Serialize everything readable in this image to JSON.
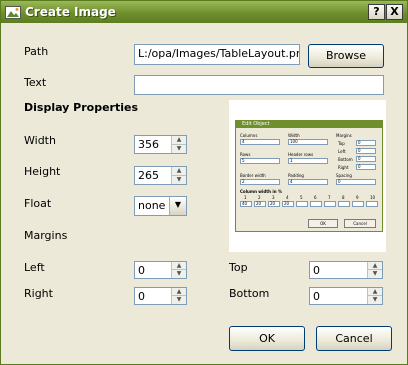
{
  "window": {
    "title": "Create Image",
    "help_btn": "?",
    "close_btn": "X"
  },
  "form": {
    "path_label": "Path",
    "path_value": "L:/opa/Images/TableLayout.png",
    "browse": "Browse",
    "text_label": "Text",
    "text_value": "",
    "display_heading": "Display Properties",
    "width_label": "Width",
    "width_value": "356",
    "height_label": "Height",
    "height_value": "265",
    "float_label": "Float",
    "float_value": "none",
    "margins_label": "Margins",
    "left_label": "Left",
    "left_value": "0",
    "top_label": "Top",
    "top_value": "0",
    "right_label": "Right",
    "right_value": "0",
    "bottom_label": "Bottom",
    "bottom_value": "0",
    "ok": "OK",
    "cancel": "Cancel"
  },
  "preview": {
    "title": "Edit Object",
    "columns_label": "Columns",
    "columns_value": "4",
    "width_label": "Width",
    "width_value": "100",
    "margins_label": "Margins",
    "top_label": "Top",
    "top_value": "0",
    "left_label": "Left",
    "left_value": "0",
    "bottom_label": "Bottom",
    "bottom_value": "0",
    "right_label": "Right",
    "right_value": "0",
    "rows_label": "Rows",
    "rows_value": "5",
    "header_rows_label": "Header rows",
    "header_rows_value": "1",
    "border_label": "Border width",
    "border_value": "2",
    "padding_label": "Padding",
    "padding_value": "4",
    "spacing_label": "Spacing",
    "spacing_value": "0",
    "colwidth_label": "Column width in %",
    "col_numbers": [
      "1",
      "2",
      "3",
      "4",
      "5",
      "6",
      "7",
      "8",
      "9",
      "10"
    ],
    "col_values": [
      "40",
      "20",
      "20",
      "20"
    ],
    "ok": "OK",
    "cancel": "Cancel"
  }
}
